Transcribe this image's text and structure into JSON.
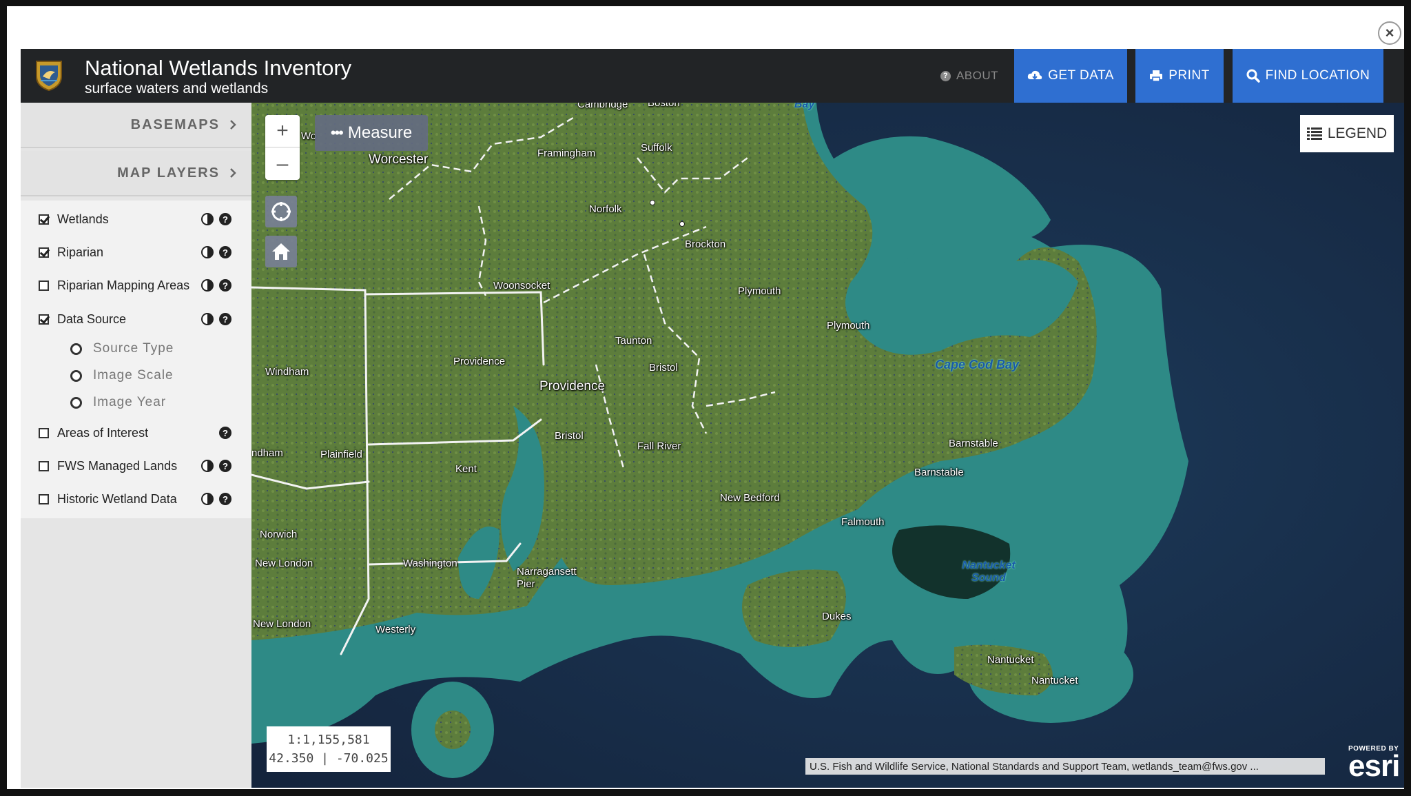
{
  "window": {
    "close_glyph": "×"
  },
  "header": {
    "title": "National Wetlands Inventory",
    "subtitle": "surface waters and wetlands",
    "about": "ABOUT",
    "get_data": "GET DATA",
    "print": "PRINT",
    "find_location": "FIND LOCATION"
  },
  "sidebar": {
    "basemaps": "BASEMAPS",
    "map_layers": "MAP LAYERS",
    "layers": [
      {
        "label": "Wetlands",
        "checked": true
      },
      {
        "label": "Riparian",
        "checked": true
      },
      {
        "label": "Riparian Mapping Areas",
        "checked": false
      },
      {
        "label": "Data Source",
        "checked": true
      },
      {
        "label": "Areas of Interest",
        "checked": false
      },
      {
        "label": "FWS Managed Lands",
        "checked": false
      },
      {
        "label": "Historic Wetland Data",
        "checked": false
      }
    ],
    "data_source_options": [
      "Source Type",
      "Image Scale",
      "Image Year"
    ]
  },
  "map": {
    "zoom_in": "+",
    "zoom_out": "–",
    "measure": "Measure",
    "legend": "LEGEND",
    "scale": "1:1,155,581",
    "coords": "42.350 | -70.025",
    "attribution": "U.S. Fish and Wildlife Service, National Standards and Support Team, wetlands_team@fws.gov ...",
    "esri_powered": "POWERED BY",
    "esri_name": "esri",
    "places": {
      "cambridge": "Cambridge",
      "boston": "Boston",
      "bay": "Bay",
      "wo": "Wo",
      "worcester": "Worcester",
      "framingham": "Framingham",
      "suffolk": "Suffolk",
      "norfolk": "Norfolk",
      "brockton": "Brockton",
      "woonsocket": "Woonsocket",
      "plymouth_county": "Plymouth",
      "plymouth": "Plymouth",
      "taunton": "Taunton",
      "bristol_ma": "Bristol",
      "providence_county": "Providence",
      "providence": "Providence",
      "windham": "Windham",
      "ndham": "ndham",
      "plainfield": "Plainfield",
      "bristol_ri": "Bristol",
      "fall_river": "Fall River",
      "kent": "Kent",
      "new_bedford": "New Bedford",
      "barnstable": "Barnstable",
      "barnstable_county": "Barnstable",
      "falmouth": "Falmouth",
      "norwich": "Norwich",
      "new_london_county": "New London",
      "washington": "Washington",
      "narragansett": "Narragansett",
      "pier": "Pier",
      "new_london": "New London",
      "westerly": "Westerly",
      "dukes": "Dukes",
      "nantucket": "Nantucket",
      "nantucket_county": "Nantucket",
      "cape_cod_bay": "Cape Cod Bay",
      "nantucket_sound": "Nantucket Sound"
    }
  },
  "colors": {
    "header_bg": "#222426",
    "button_blue": "#2f6fd1",
    "land": "#5b7a3a",
    "shallow_water": "#2e8a86",
    "deep_water": "#17263f"
  }
}
